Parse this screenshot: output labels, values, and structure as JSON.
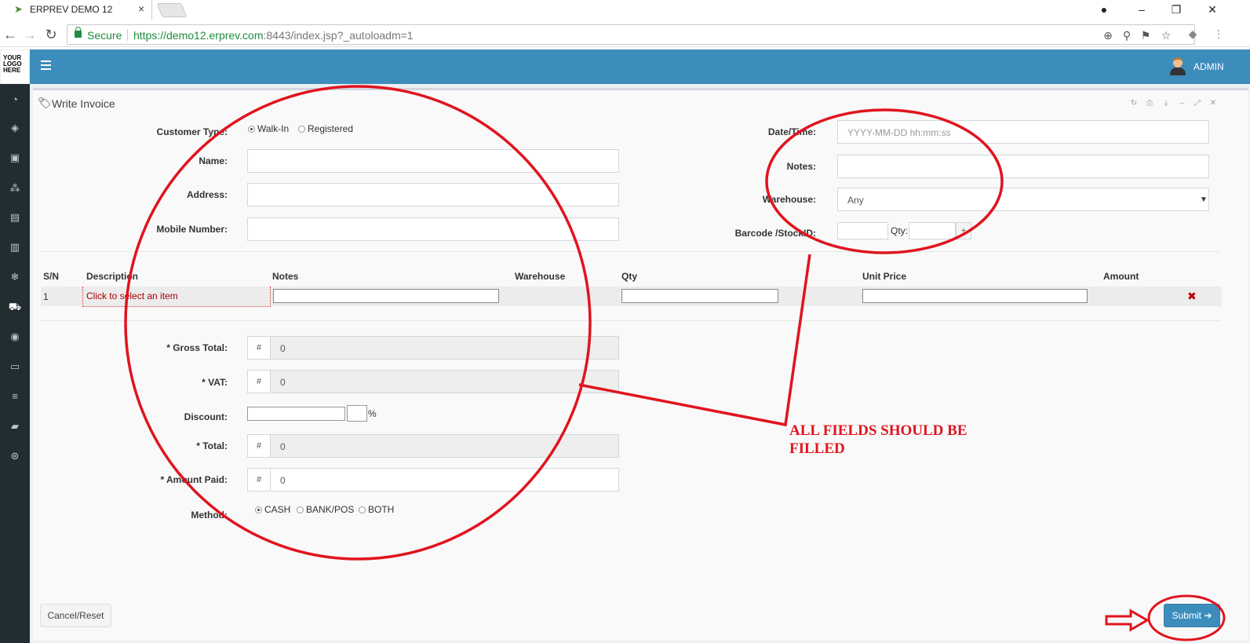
{
  "browser": {
    "tab_title": "ERPREV DEMO 12",
    "tab_close": "×",
    "secure_label": "Secure",
    "url_scheme_host": "https://demo12.erprev.com",
    "url_rest": ":8443/index.jsp?_autoloadm=1"
  },
  "logo": {
    "line1": "YOUR",
    "line2": "LOGO",
    "line3": "HERE"
  },
  "header": {
    "user_name": "ADMIN"
  },
  "sidebar": {
    "icons": [
      "dashboard-icon",
      "tag-icon",
      "money-icon",
      "cubes-icon",
      "building-icon",
      "trash-icon",
      "snowflake-icon",
      "cart-icon",
      "circle-icon",
      "desktop-icon",
      "database-icon",
      "book-icon",
      "lifebuoy-icon"
    ]
  },
  "box": {
    "title": "Write Invoice"
  },
  "form": {
    "customer_type_label": "Customer Type:",
    "customer_type_options": [
      "Walk-In",
      "Registered"
    ],
    "name_label": "Name:",
    "address_label": "Address:",
    "mobile_label": "Mobile Number:",
    "datetime_label": "Date/Time:",
    "datetime_placeholder": "YYYY-MM-DD hh:mm:ss",
    "notes_label": "Notes:",
    "warehouse_label": "Warehouse:",
    "warehouse_value": "Any",
    "barcode_label": "Barcode /StockID:",
    "qty_label": "Qty:",
    "add_label": "+"
  },
  "table": {
    "headers": [
      "S/N",
      "Description",
      "Notes",
      "Warehouse",
      "Qty",
      "Unit Price",
      "Amount"
    ],
    "rows": [
      {
        "sn": "1",
        "description": "Click to select an item",
        "remove": "✖"
      }
    ]
  },
  "totals": {
    "gross_total_label": "* Gross Total:",
    "vat_label": "* VAT:",
    "discount_label": "Discount:",
    "total_label": "* Total:",
    "amount_paid_label": "* Amount Paid:",
    "currency_symbol": "#",
    "gross_total_value": "0",
    "vat_value": "0",
    "total_value": "0",
    "amount_paid_value": "0",
    "percent": "%",
    "method_label": "Method:",
    "method_options": [
      "CASH",
      "BANK/POS",
      "BOTH"
    ]
  },
  "actions": {
    "cancel_label": "Cancel/Reset",
    "submit_label": "Submit"
  },
  "annotation": {
    "text": "ALL FIELDS SHOULD BE FILLED",
    "color": "#e0141e"
  },
  "colors": {
    "header": "#3c8dbc",
    "sidebar": "#222d32",
    "accent_red": "#e0141e"
  }
}
